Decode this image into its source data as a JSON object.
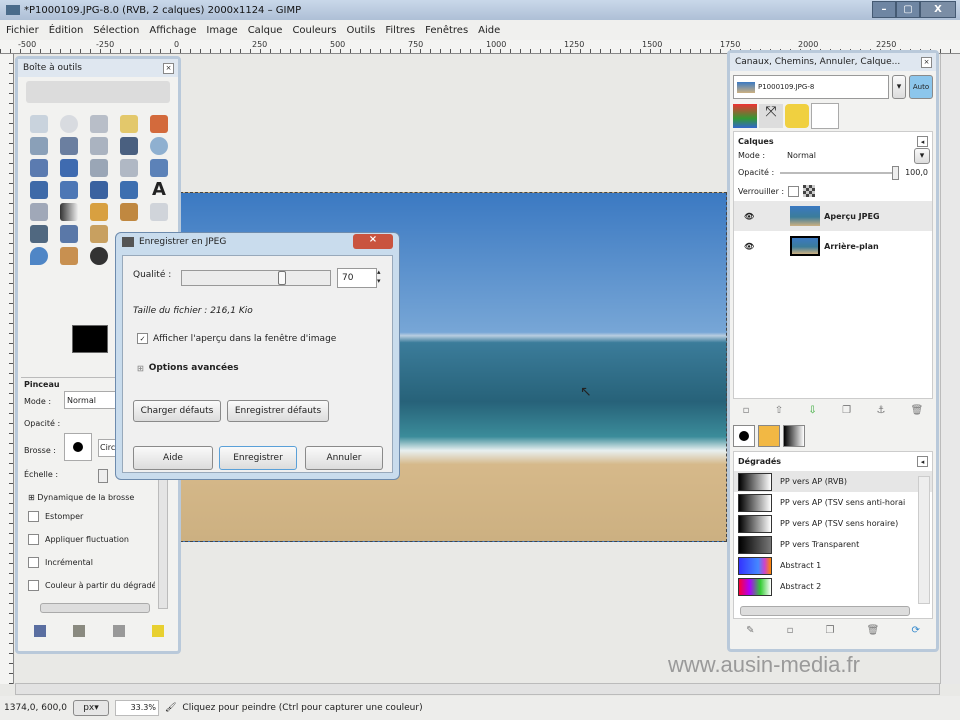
{
  "window": {
    "title": "*P1000109.JPG-8.0 (RVB, 2 calques) 2000x1124 – GIMP",
    "minimize": "–",
    "maximize": "▢",
    "close": "X"
  },
  "menu": [
    "Fichier",
    "Édition",
    "Sélection",
    "Affichage",
    "Image",
    "Calque",
    "Couleurs",
    "Outils",
    "Filtres",
    "Fenêtres",
    "Aide"
  ],
  "ruler": [
    "-500",
    "-250",
    "0",
    "250",
    "500",
    "750",
    "1000",
    "1250",
    "1500",
    "1750",
    "2000",
    "2250"
  ],
  "toolbox": {
    "title": "Boîte à outils",
    "options_title": "Pinceau",
    "mode_label": "Mode :",
    "mode_value": "Normal",
    "opacity_label": "Opacité :",
    "brush_label": "Brosse :",
    "brush_value": "Circle",
    "scale_label": "Échelle :",
    "dynamics": "Dynamique de la brosse",
    "checks": [
      "Estomper",
      "Appliquer fluctuation",
      "Incrémental",
      "Couleur à partir du dégradé"
    ]
  },
  "dialog": {
    "title": "Enregistrer en JPEG",
    "quality_label": "Qualité :",
    "quality_value": "70",
    "quality": 70,
    "filesize": "Taille du fichier : 216,1 Kio",
    "preview_label": "Afficher l'aperçu dans la fenêtre d'image",
    "preview_checked": true,
    "advanced": "Options avancées",
    "load_defaults": "Charger défauts",
    "save_defaults": "Enregistrer défauts",
    "help": "Aide",
    "save": "Enregistrer",
    "cancel": "Annuler"
  },
  "dock": {
    "title": "Canaux, Chemins, Annuler, Calque...",
    "image_name": "P1000109.JPG-8",
    "auto": "Auto",
    "layers_title": "Calques",
    "mode_label": "Mode :",
    "mode_value": "Normal",
    "opacity_label": "Opacité :",
    "opacity_value": "100,0",
    "lock_label": "Verrouiller :",
    "layers": [
      "Aperçu JPEG",
      "Arrière-plan"
    ],
    "gradients_title": "Dégradés",
    "gradients": [
      "PP vers AP (RVB)",
      "PP vers AP (TSV sens anti-horaire)",
      "PP vers AP (TSV sens horaire)",
      "PP vers Transparent",
      "Abstract 1",
      "Abstract 2"
    ]
  },
  "status": {
    "coords": "1374,0, 600,0",
    "unit": "px",
    "zoom": "33.3%",
    "message": "Cliquez pour peindre (Ctrl pour capturer une couleur)"
  },
  "watermark": "www.ausin-media.fr"
}
